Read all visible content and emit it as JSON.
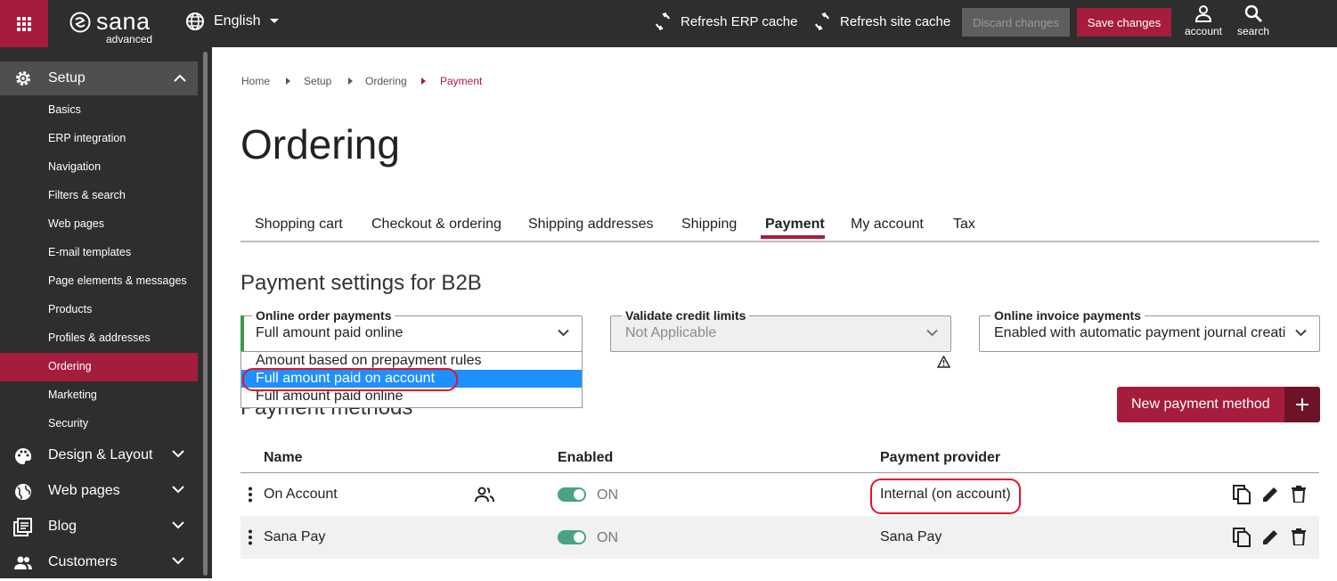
{
  "topbar": {
    "logo_word": "sana",
    "logo_sub": "advanced",
    "language": "English",
    "refresh_erp": "Refresh ERP cache",
    "refresh_site": "Refresh site cache",
    "discard": "Discard changes",
    "save": "Save changes",
    "account": "account",
    "search": "search"
  },
  "sidebar": {
    "setup": "Setup",
    "sub_items": [
      "Basics",
      "ERP integration",
      "Navigation",
      "Filters & search",
      "Web pages",
      "E-mail templates",
      "Page elements & messages",
      "Products",
      "Profiles & addresses",
      "Ordering",
      "Marketing",
      "Security"
    ],
    "active_item": "Ordering",
    "main_items": [
      "Design & Layout",
      "Web pages",
      "Blog",
      "Customers"
    ]
  },
  "breadcrumb": [
    "Home",
    "Setup",
    "Ordering",
    "Payment"
  ],
  "page_title": "Ordering",
  "tabs": [
    "Shopping cart",
    "Checkout & ordering",
    "Shipping addresses",
    "Shipping",
    "Payment",
    "My account",
    "Tax"
  ],
  "active_tab": "Payment",
  "settings": {
    "title": "Payment settings for B2B",
    "online_order": {
      "label": "Online order payments",
      "value": "Full amount paid online"
    },
    "credit_limits": {
      "label": "Validate credit limits",
      "value": "Not Applicable"
    },
    "invoice": {
      "label": "Online invoice payments",
      "value": "Enabled with automatic payment journal creati"
    },
    "dropdown_options": [
      "Amount based on prepayment rules",
      "Full amount paid on account",
      "Full amount paid online"
    ],
    "highlighted_option": "Full amount paid on account"
  },
  "methods": {
    "title": "Payment methods",
    "new_button": "New payment method",
    "headers": {
      "name": "Name",
      "enabled": "Enabled",
      "provider": "Payment provider"
    },
    "rows": [
      {
        "name": "On Account",
        "enabled": "ON",
        "provider": "Internal (on account)"
      },
      {
        "name": "Sana Pay",
        "enabled": "ON",
        "provider": "Sana Pay"
      }
    ]
  },
  "colors": {
    "brand": "#a51c3c",
    "toggle": "#4aa383",
    "highlight": "#1e90ff",
    "annotation": "#e0162b"
  }
}
